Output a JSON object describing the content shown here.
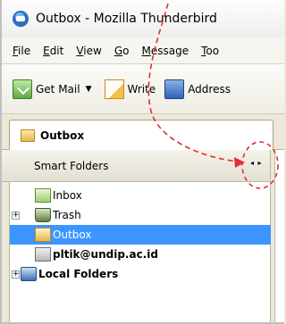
{
  "window": {
    "title": "Outbox - Mozilla Thunderbird"
  },
  "menubar": {
    "items": [
      "File",
      "Edit",
      "View",
      "Go",
      "Message",
      "Too"
    ]
  },
  "toolbar": {
    "get_mail_label": "Get Mail",
    "write_label": "Write",
    "address_label": "Address"
  },
  "tab": {
    "label": "Outbox"
  },
  "folder_pane": {
    "header_label": "Smart Folders",
    "nav_arrows": "◂ ▸",
    "folders": [
      {
        "label": "Inbox",
        "icon": "inbox-icon",
        "expandable": false,
        "selected": false,
        "bold": false
      },
      {
        "label": "Trash",
        "icon": "trash-icon",
        "expandable": true,
        "selected": false,
        "bold": false
      },
      {
        "label": "Outbox",
        "icon": "outbox-icon",
        "expandable": false,
        "selected": true,
        "bold": false
      },
      {
        "label": "pltik@undip.ac.id",
        "icon": "account-icon",
        "expandable": false,
        "selected": false,
        "bold": true
      },
      {
        "label": "Local Folders",
        "icon": "local-folders-icon",
        "expandable": true,
        "selected": false,
        "bold": true
      }
    ]
  },
  "colors": {
    "selection": "#3d95ff",
    "annotation": "#e03030"
  }
}
